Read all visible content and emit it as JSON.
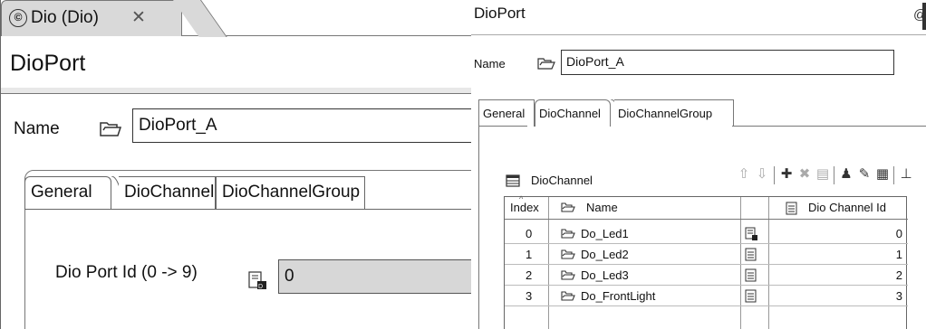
{
  "left": {
    "editor_tab": {
      "icon": "module-icon",
      "label": "Dio (Dio)",
      "close": "✕"
    },
    "title": "DioPort",
    "name_label": "Name",
    "name_value": "DioPort_A",
    "tabs": [
      "General",
      "DioChannel",
      "DioChannelGroup"
    ],
    "active_tab": "General",
    "port_id_label": "Dio Port Id (0 -> 9)",
    "port_id_value": "0"
  },
  "right": {
    "title": "DioPort",
    "header_glyph": "@",
    "name_label": "Name",
    "name_value": "DioPort_A",
    "tabs": [
      "General",
      "DioChannel",
      "DioChannelGroup"
    ],
    "active_tab": "DioChannel",
    "table_title": "DioChannel",
    "toolbar_icons": [
      "move-up-icon",
      "move-down-icon",
      "add-icon",
      "delete-icon",
      "copy-icon",
      "users-icon",
      "edit-icon",
      "edit-form-icon",
      "export-icon"
    ],
    "columns": [
      "Index",
      "Name",
      "Dio Channel Id"
    ],
    "rows": [
      {
        "index": "0",
        "name": "Do_Led1",
        "id": "0"
      },
      {
        "index": "1",
        "name": "Do_Led2",
        "id": "1"
      },
      {
        "index": "2",
        "name": "Do_Led3",
        "id": "2"
      },
      {
        "index": "3",
        "name": "Do_FrontLight",
        "id": "3"
      }
    ]
  }
}
